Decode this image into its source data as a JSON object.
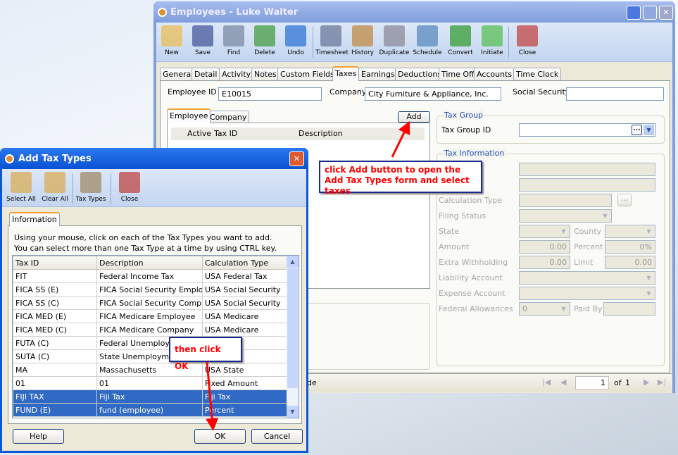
{
  "main_window": {
    "title": "Employees - Luke  Walter",
    "toolbar": [
      "New",
      "Save",
      "Find",
      "Delete",
      "Undo",
      "Timesheet",
      "History",
      "Duplicate",
      "Schedule",
      "Convert",
      "Initiate",
      "Close"
    ],
    "tabs": [
      "General",
      "Detail",
      "Activity",
      "Notes",
      "Custom Fields",
      "Taxes",
      "Earnings",
      "Deductions",
      "Time Off",
      "Accounts",
      "Time Clock"
    ],
    "active_tab": "Taxes",
    "employee_id_label": "Employee ID",
    "employee_id": "E10015",
    "company_label": "Company",
    "company": "City Furniture & Appliance, Inc.",
    "ssn_label": "Social Security",
    "ssn": "",
    "subtabs": [
      "Employee",
      "Company"
    ],
    "add_button": "Add",
    "grid_headers": [
      "Active",
      "Tax ID",
      "Description"
    ],
    "tax_group": {
      "title": "Tax Group",
      "id_label": "Tax Group ID",
      "id_value": "",
      "ellipsis": "..."
    },
    "tax_info": {
      "title": "Tax Information",
      "calc_type": "Calculation Type",
      "filing_status": "Filing Status",
      "state": "State",
      "county": "County",
      "amount": "Amount",
      "amount_value": "0.00",
      "percent": "Percent",
      "percent_value": "0%",
      "extra": "Extra Withholding",
      "extra_value": "0.00",
      "limit": "Limit",
      "limit_value": "0.00",
      "liability": "Liability Account",
      "expense": "Expense Account",
      "fed_allow": "Federal Allowances",
      "fed_allow_value": "0",
      "paid_by": "Paid By",
      "ellipsis": "..."
    },
    "status_text": "de",
    "pager": {
      "page": "1",
      "of": "of",
      "total": "1"
    }
  },
  "dialog": {
    "title": "Add Tax Types",
    "toolbar": [
      "Select All",
      "Clear All",
      "Tax Types",
      "Close"
    ],
    "tab": "Information",
    "instructions": [
      "Using your mouse, click on each of the Tax Types you want to add.",
      "You can select more than one Tax Type at a time by using CTRL key."
    ],
    "headers": [
      "Tax ID",
      "Description",
      "Calculation Type"
    ],
    "rows": [
      [
        "FIT",
        "Federal Income Tax",
        "USA Federal Tax",
        false
      ],
      [
        "FICA SS (E)",
        "FICA Social Security Employee",
        "USA Social Security",
        false
      ],
      [
        "FICA SS (C)",
        "FICA Social Security Company",
        "USA Social Security",
        false
      ],
      [
        "FICA MED (E)",
        "FICA Medicare Employee",
        "USA Medicare",
        false
      ],
      [
        "FICA MED (C)",
        "FICA Medicare Company",
        "USA Medicare",
        false
      ],
      [
        "FUTA (C)",
        "Federal Unemployment",
        "",
        false
      ],
      [
        "SUTA (C)",
        "State Unemployment",
        "",
        false
      ],
      [
        "MA",
        "Massachusetts",
        "USA State",
        false
      ],
      [
        "01",
        "01",
        "Fixed Amount",
        false
      ],
      [
        "FIJI TAX",
        "Fiji Tax",
        "Fiji Tax",
        true
      ],
      [
        "FUND (E)",
        "fund (employee)",
        "Percent",
        true
      ]
    ],
    "help": "Help",
    "ok": "OK",
    "cancel": "Cancel"
  },
  "callouts": {
    "add": "click Add button to open the Add Tax Types form and select taxes",
    "ok": "then click OK"
  }
}
